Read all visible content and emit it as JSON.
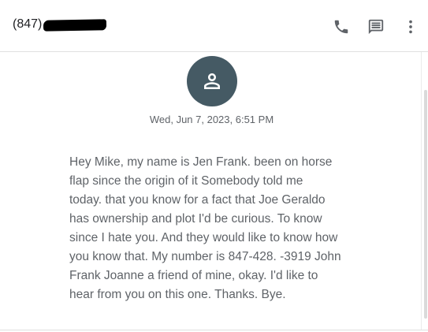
{
  "header": {
    "phone_number": "(847)",
    "icons": [
      "phone-icon",
      "message-icon",
      "more-vert-icon"
    ]
  },
  "conversation": {
    "avatar_icon": "person-icon",
    "avatar_color": "#455a64",
    "timestamp": "Wed, Jun 7, 2023, 6:51 PM",
    "message": "Hey Mike, my name is Jen Frank. been on horse\nflap since the origin of it Somebody told me\ntoday. that you know for a fact that Joe Geraldo\nhas ownership and plot I'd be curious. To know\nsince I hate you. And they would like to know how\nyou know that. My number is 847-428. -3919 John\nFrank Joanne a friend of mine, okay. I'd like to\nhear from you on this one. Thanks. Bye."
  }
}
